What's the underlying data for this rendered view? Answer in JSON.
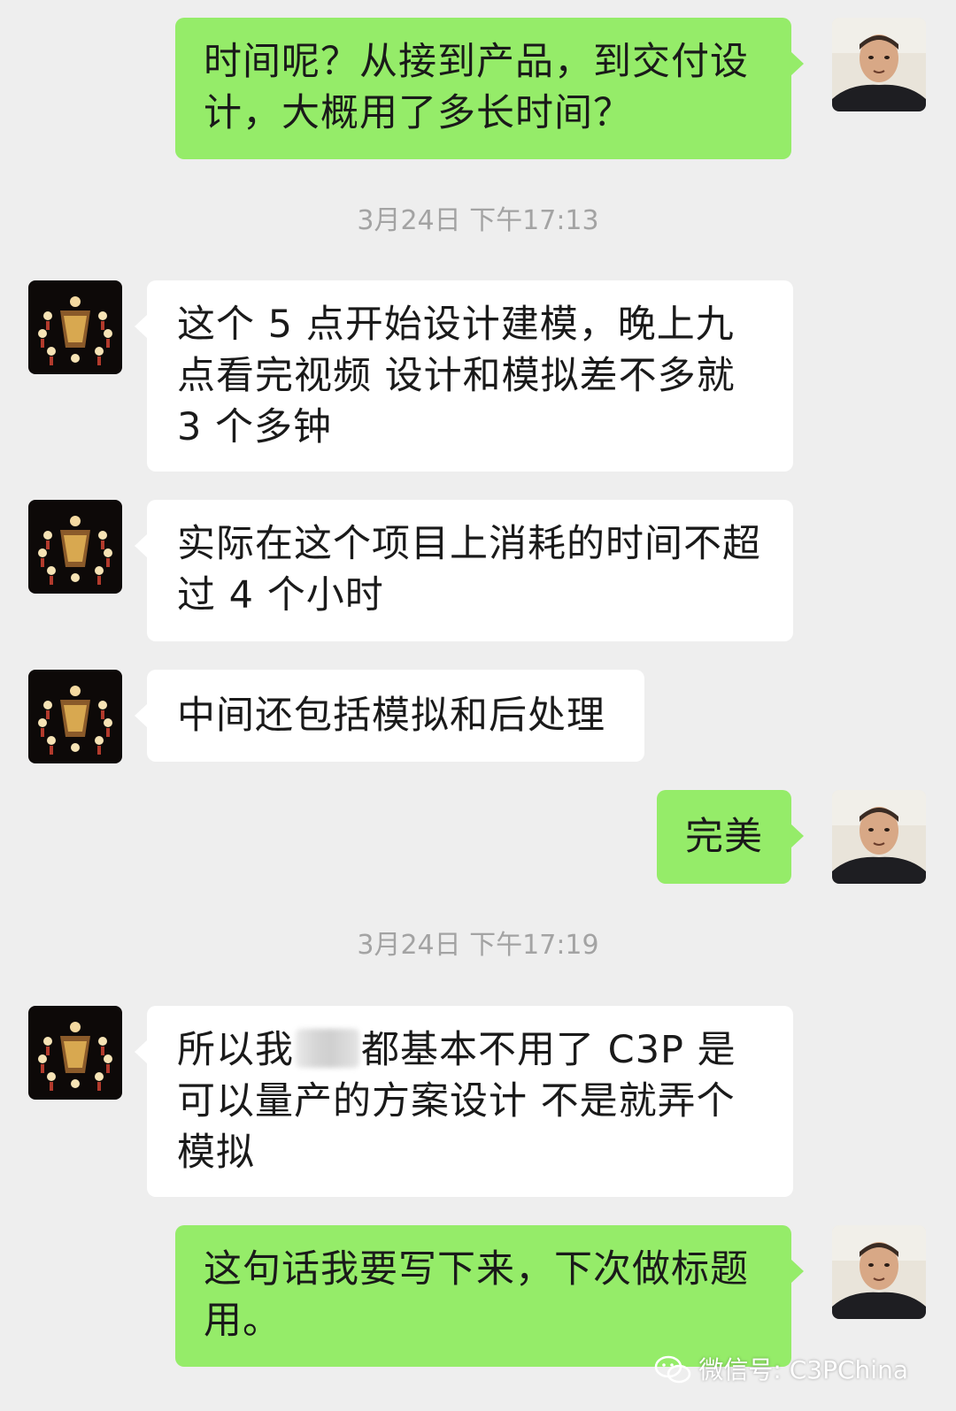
{
  "colors": {
    "background": "#eeeeee",
    "self_bubble": "#95ec69",
    "other_bubble": "#ffffff",
    "timestamp_text": "#a3a3a3"
  },
  "messages": [
    {
      "sender": "self",
      "text": "时间呢？从接到产品，到交付设计，大概用了多长时间？"
    },
    {
      "sender": "other",
      "text": "这个 5 点开始设计建模，晚上九点看完视频  设计和模拟差不多就 3 个多钟"
    },
    {
      "sender": "other",
      "text": "实际在这个项目上消耗的时间不超过 4 个小时"
    },
    {
      "sender": "other",
      "text": "中间还包括模拟和后处理"
    },
    {
      "sender": "self",
      "text": "完美"
    },
    {
      "sender": "other",
      "text_before": "所以我",
      "text_after": "都基本不用了  C3P 是可以量产的方案设计 不是就弄个模拟"
    },
    {
      "sender": "self",
      "text": "这句话我要写下来，下次做标题用。"
    }
  ],
  "timestamps": [
    "3月24日 下午17:13",
    "3月24日 下午17:19"
  ],
  "watermark": {
    "icon": "wechat-logo-icon",
    "text": "微信号: C3PChina"
  }
}
